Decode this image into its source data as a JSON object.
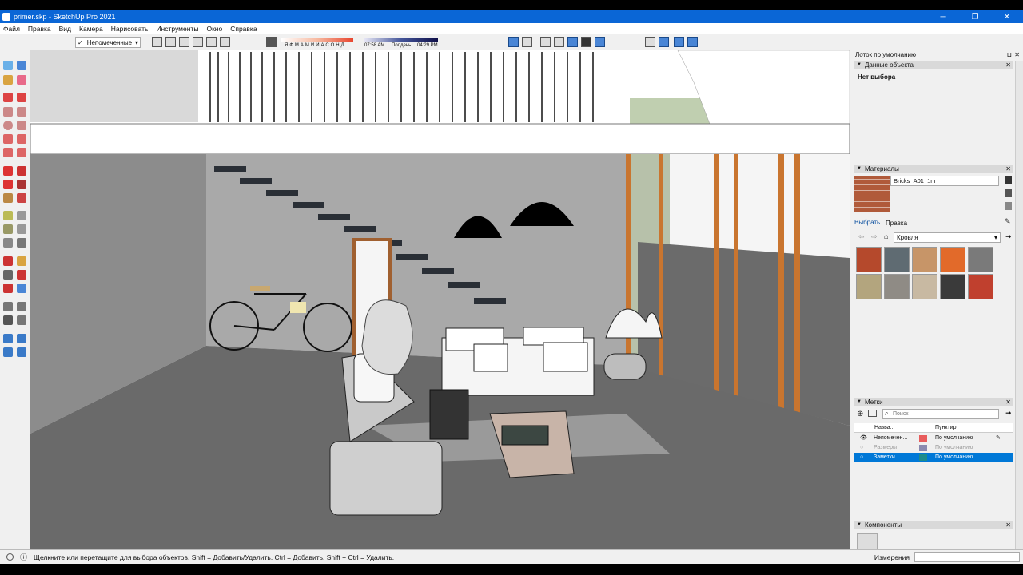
{
  "window": {
    "title": "primer.skp - SketchUp Pro 2021",
    "minimize": "─",
    "maximize": "❐",
    "close": "✕"
  },
  "menu": [
    "Файл",
    "Правка",
    "Вид",
    "Камера",
    "Нарисовать",
    "Инструменты",
    "Окно",
    "Справка"
  ],
  "toolbar": {
    "tag_check": "✓",
    "tag_selector": "Непомеченные",
    "shadow_months": "ЯФМАМИИАСОНД",
    "time_start": "07:58 AM",
    "time_noon": "Полдень",
    "time_end": "04:29 PM"
  },
  "tray": {
    "title": "Лоток по умолчанию",
    "entity_info": {
      "header": "Данные объекта",
      "value": "Нет выбора"
    },
    "materials": {
      "header": "Материалы",
      "name": "Bricks_A01_1m",
      "tab_select": "Выбрать",
      "tab_edit": "Правка",
      "category": "Кровля",
      "swatches": [
        "#b5492c",
        "#5f6b72",
        "#c79568",
        "#e26a2a",
        "#7a7a7a",
        "#b3a57e",
        "#8f8b85",
        "#c8b9a2",
        "#3a3a3a",
        "#c0402e"
      ]
    },
    "tags": {
      "header": "Метки",
      "search_placeholder": "Поиск",
      "col_name": "Назва...",
      "col_dash": "Пунктир",
      "rows": [
        {
          "name": "Непомечен...",
          "dash": "По умолчанию",
          "color": "#e85c5c"
        },
        {
          "name": "Размеры",
          "dash": "По умолчанию",
          "color": "#8a8ab0"
        },
        {
          "name": "Заметки",
          "dash": "По умолчанию",
          "color": "#1d8c8c"
        }
      ]
    },
    "components": {
      "header": "Компоненты"
    }
  },
  "status": {
    "message": "Щелкните или перетащите для выбора объектов. Shift = Добавить/Удалить. Ctrl = Добавить. Shift + Ctrl = Удалить.",
    "measurements_label": "Измерения"
  }
}
